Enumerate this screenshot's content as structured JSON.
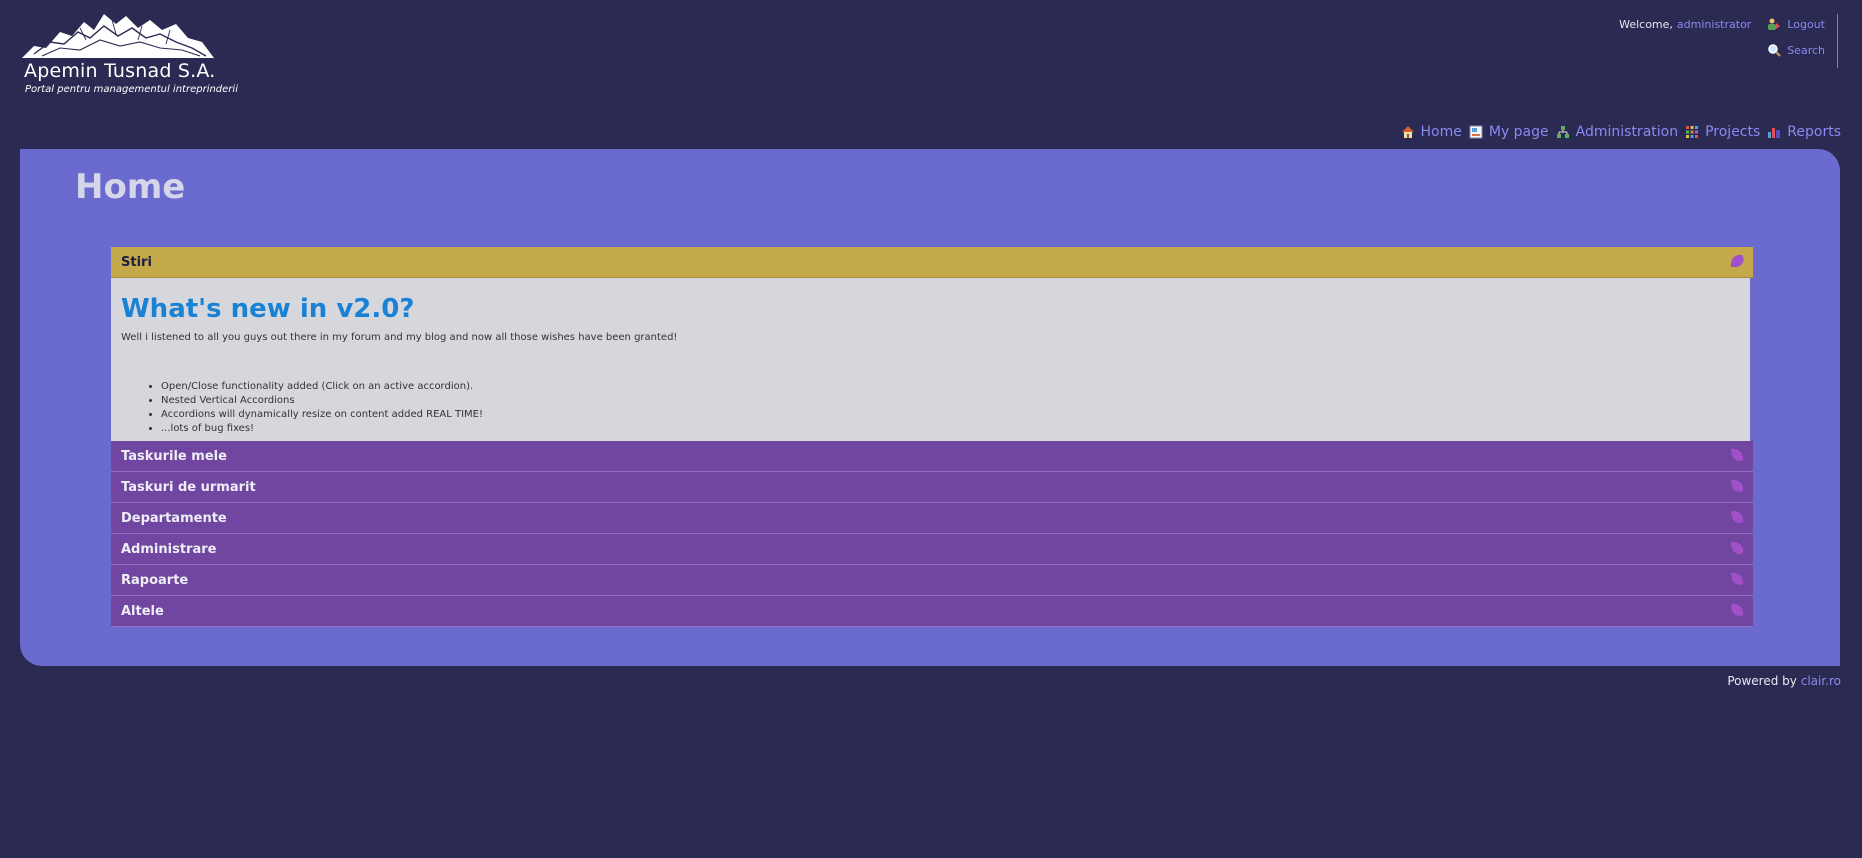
{
  "header": {
    "company": "Apemin Tusnad S.A.",
    "tagline": "Portal pentru managementul intreprinderii"
  },
  "user": {
    "welcome": "Welcome,",
    "username": "administrator",
    "logout": "Logout",
    "search": "Search"
  },
  "nav": [
    {
      "label": "Home",
      "icon": "home-icon"
    },
    {
      "label": "My page",
      "icon": "my-page-icon"
    },
    {
      "label": "Administration",
      "icon": "administration-icon"
    },
    {
      "label": "Projects",
      "icon": "projects-icon"
    },
    {
      "label": "Reports",
      "icon": "reports-icon"
    }
  ],
  "page_title": "Home",
  "accordion": {
    "active": {
      "title": "Stiri",
      "heading": "What's new in v2.0?",
      "text": "Well i listened to all you guys out there in my forum and my blog and now all those wishes have been granted!",
      "items": [
        "Open/Close functionality added (Click on an active accordion).",
        "Nested Vertical Accordions",
        "Accordions will dynamically resize on content added REAL TIME!",
        "...lots of bug fixes!"
      ]
    },
    "sections": [
      "Taskurile mele",
      "Taskuri de urmarit",
      "Departamente",
      "Administrare",
      "Rapoarte",
      "Altele"
    ]
  },
  "footer": {
    "powered": "Powered by",
    "link": "clair.ro"
  },
  "colors": {
    "background": "#2a2a52",
    "panel": "#6b6bcf",
    "active_header": "#c4a94b",
    "section_header": "#7146a0",
    "link": "#8a8af0",
    "heading": "#1a82d4"
  }
}
